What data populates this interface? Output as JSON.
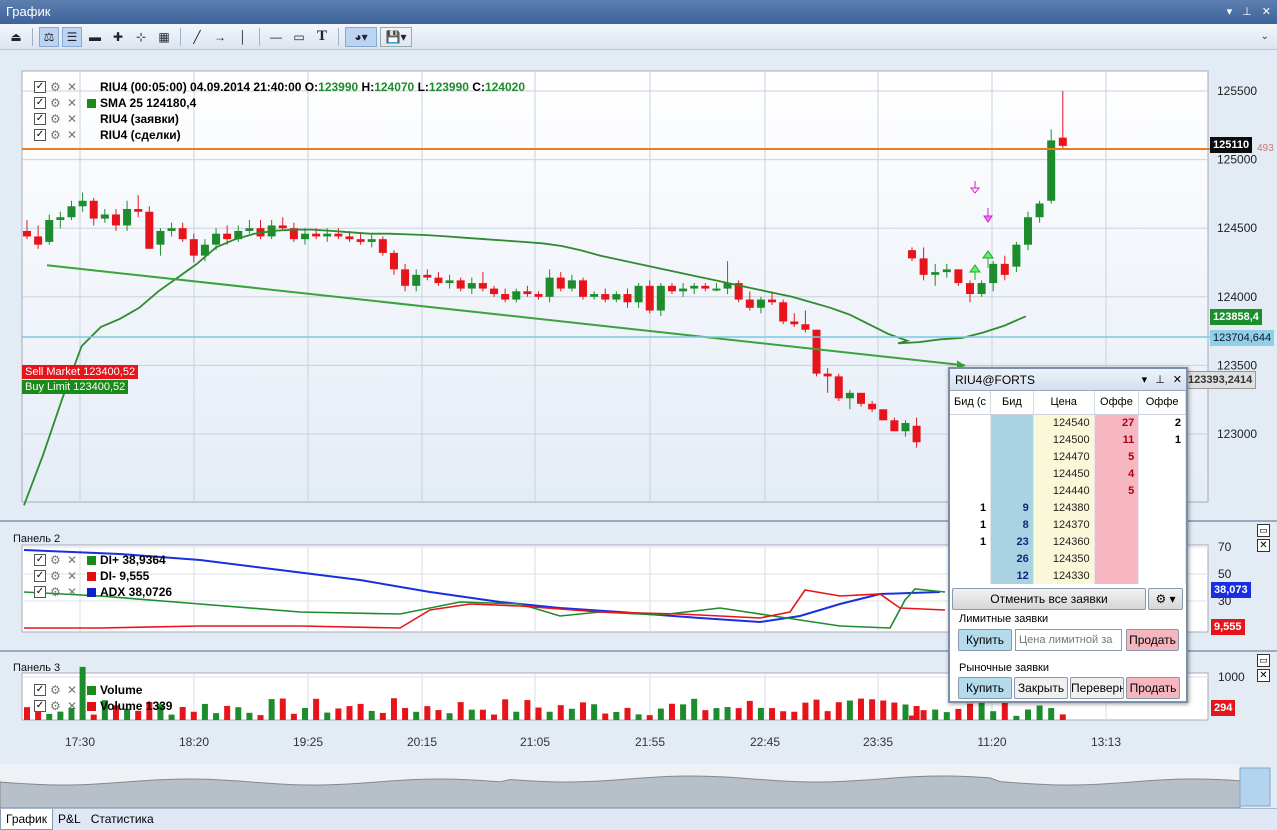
{
  "window": {
    "title": "График"
  },
  "toolbar": {
    "icons": [
      "open-icon",
      "candles-icon",
      "legend-icon",
      "horizontal-line-icon",
      "crosshair-icon",
      "marker-icon",
      "indicator-icon",
      "draw-line-icon",
      "arrow-icon",
      "vertical-line-icon",
      "hline-icon",
      "rectangle-icon",
      "text-icon",
      "color-icon",
      "save-icon"
    ]
  },
  "legend": {
    "main": [
      {
        "text": "RIU4 (00:05:00)  04.09.2014 21:40:00",
        "parts": [
          [
            "O:",
            "123990"
          ],
          [
            "H:",
            "124070"
          ],
          [
            "L:",
            "123990"
          ],
          [
            "C:",
            "124020"
          ]
        ]
      },
      {
        "text": "SMA 25  124180,4",
        "color": "#1a8a1a"
      },
      {
        "text": "RIU4 (заявки)"
      },
      {
        "text": "RIU4 (сделки)"
      }
    ],
    "panel2": [
      {
        "text": "DI+ 38,9364",
        "color": "#1a8a1a"
      },
      {
        "text": "DI- 9,555",
        "color": "#e01010"
      },
      {
        "text": "ADX 38,0726",
        "color": "#0a22c8"
      }
    ],
    "panel3": [
      {
        "text": "Volume",
        "color": "#1a8a1a"
      },
      {
        "text": "Volume 1339",
        "color": "#e01010"
      }
    ]
  },
  "panels": {
    "panel2_title": "Панель 2",
    "panel3_title": "Панель 3"
  },
  "axis": {
    "price_ticks": [
      "125500",
      "125000",
      "124500",
      "124000",
      "123500",
      "123000"
    ],
    "panel2_ticks": [
      "70",
      "50",
      "30"
    ],
    "panel3_ticks": [
      "1000"
    ],
    "time_ticks": [
      "17:30",
      "18:20",
      "19:25",
      "20:15",
      "21:05",
      "21:55",
      "22:45",
      "23:35",
      "11:20",
      "13:13"
    ]
  },
  "price_boxes": {
    "last": "125110",
    "last_hidden": "493",
    "sma": "123858,4",
    "hline": "123704,644",
    "cursor": "123393,2414",
    "di_plus": "38,073",
    "di_minus": "9,555",
    "volume": "294"
  },
  "orders": {
    "sell": "Sell Market 123400,52",
    "buy": "Buy Limit 123400,52"
  },
  "colors": {
    "bull": "#1d8c2d",
    "bear": "#e8141b",
    "sma": "#2e8b2e",
    "last_line": "#ee7b22",
    "hline": "#7ec8e3",
    "trend": "#3aa33a",
    "adx": "#1a2ee0"
  },
  "chart_data": {
    "type": "candlestick",
    "title": "RIU4 (00:05:00)",
    "last_close": 125110,
    "ylim": [
      122800,
      125650
    ],
    "candles": [
      [
        124480,
        124560,
        124420,
        124440
      ],
      [
        124440,
        124520,
        124350,
        124380
      ],
      [
        124400,
        124600,
        124380,
        124560
      ],
      [
        124560,
        124620,
        124500,
        124580
      ],
      [
        124580,
        124700,
        124560,
        124660
      ],
      [
        124660,
        124760,
        124620,
        124700
      ],
      [
        124700,
        124720,
        124520,
        124570
      ],
      [
        124570,
        124640,
        124540,
        124600
      ],
      [
        124600,
        124640,
        124480,
        124520
      ],
      [
        124520,
        124700,
        124480,
        124640
      ],
      [
        124640,
        124740,
        124580,
        124620
      ],
      [
        124620,
        124660,
        124350,
        124350
      ],
      [
        124380,
        124500,
        124300,
        124480
      ],
      [
        124480,
        124540,
        124440,
        124500
      ],
      [
        124500,
        124540,
        124400,
        124420
      ],
      [
        124420,
        124460,
        124250,
        124300
      ],
      [
        124300,
        124420,
        124260,
        124380
      ],
      [
        124380,
        124500,
        124340,
        124460
      ],
      [
        124460,
        124520,
        124380,
        124420
      ],
      [
        124420,
        124520,
        124400,
        124480
      ],
      [
        124480,
        124560,
        124460,
        124500
      ],
      [
        124500,
        124560,
        124420,
        124440
      ],
      [
        124440,
        124560,
        124420,
        124520
      ],
      [
        124520,
        124580,
        124480,
        124500
      ],
      [
        124500,
        124540,
        124400,
        124420
      ],
      [
        124420,
        124500,
        124380,
        124460
      ],
      [
        124460,
        124500,
        124420,
        124440
      ],
      [
        124440,
        124500,
        124400,
        124460
      ],
      [
        124460,
        124500,
        124420,
        124440
      ],
      [
        124440,
        124480,
        124400,
        124420
      ],
      [
        124420,
        124460,
        124380,
        124400
      ],
      [
        124400,
        124460,
        124360,
        124420
      ],
      [
        124420,
        124440,
        124300,
        124320
      ],
      [
        124320,
        124340,
        124160,
        124200
      ],
      [
        124200,
        124240,
        124040,
        124080
      ],
      [
        124080,
        124200,
        124040,
        124160
      ],
      [
        124160,
        124200,
        124120,
        124140
      ],
      [
        124140,
        124180,
        124080,
        124100
      ],
      [
        124100,
        124160,
        124060,
        124120
      ],
      [
        124120,
        124140,
        124040,
        124060
      ],
      [
        124060,
        124140,
        124020,
        124100
      ],
      [
        124100,
        124180,
        124040,
        124060
      ],
      [
        124060,
        124080,
        124000,
        124020
      ],
      [
        124020,
        124060,
        123960,
        123980
      ],
      [
        123980,
        124060,
        123960,
        124040
      ],
      [
        124040,
        124080,
        124000,
        124020
      ],
      [
        124020,
        124040,
        123980,
        124000
      ],
      [
        124000,
        124200,
        123960,
        124140
      ],
      [
        124140,
        124180,
        124040,
        124060
      ],
      [
        124060,
        124160,
        124040,
        124120
      ],
      [
        124120,
        124140,
        123980,
        124000
      ],
      [
        124000,
        124040,
        123980,
        124020
      ],
      [
        124020,
        124060,
        123960,
        123980
      ],
      [
        123980,
        124040,
        123960,
        124020
      ],
      [
        124020,
        124060,
        123920,
        123960
      ],
      [
        123960,
        124100,
        123920,
        124080
      ],
      [
        124080,
        124120,
        123880,
        123900
      ],
      [
        123900,
        124100,
        123860,
        124080
      ],
      [
        124080,
        124100,
        124020,
        124040
      ],
      [
        124040,
        124100,
        124000,
        124060
      ],
      [
        124060,
        124100,
        124020,
        124080
      ],
      [
        124080,
        124100,
        124040,
        124060
      ],
      [
        124060,
        124100,
        124040,
        124060
      ],
      [
        124060,
        124260,
        124020,
        124100
      ],
      [
        124100,
        124120,
        123960,
        123980
      ],
      [
        123980,
        124040,
        123900,
        123920
      ],
      [
        123920,
        124000,
        123880,
        123980
      ],
      [
        123980,
        124040,
        123940,
        123960
      ],
      [
        123960,
        123980,
        123800,
        123820
      ],
      [
        123820,
        123880,
        123780,
        123800
      ],
      [
        123800,
        123900,
        123740,
        123760
      ],
      [
        123760,
        123760,
        123420,
        123440
      ],
      [
        123440,
        123480,
        123300,
        123420
      ],
      [
        123420,
        123440,
        123240,
        123260
      ],
      [
        123260,
        123320,
        123180,
        123300
      ],
      [
        123300,
        123300,
        123200,
        123220
      ],
      [
        123220,
        123240,
        123160,
        123180
      ],
      [
        123180,
        123180,
        123100,
        123100
      ],
      [
        123100,
        123120,
        123020,
        123020
      ],
      [
        123020,
        123100,
        122980,
        123080
      ],
      [
        123060,
        123120,
        122900,
        122940
      ],
      [
        124340,
        124360,
        124260,
        124280
      ],
      [
        124280,
        124360,
        124120,
        124160
      ],
      [
        124160,
        124240,
        124080,
        124180
      ],
      [
        124180,
        124240,
        124140,
        124200
      ],
      [
        124200,
        124200,
        124080,
        124100
      ],
      [
        124100,
        124120,
        123960,
        124020
      ],
      [
        124020,
        124120,
        124000,
        124100
      ],
      [
        124100,
        124260,
        124040,
        124240
      ],
      [
        124240,
        124300,
        124120,
        124160
      ],
      [
        124220,
        124400,
        124180,
        124380
      ],
      [
        124380,
        124620,
        124340,
        124580
      ],
      [
        124580,
        124700,
        124540,
        124680
      ],
      [
        124700,
        125220,
        124680,
        125140
      ],
      [
        125160,
        125500,
        125080,
        125100
      ]
    ],
    "sma_points": [
      [
        0,
        122480
      ],
      [
        1,
        122850
      ],
      [
        2,
        123260
      ],
      [
        3,
        123640
      ],
      [
        4,
        123780
      ],
      [
        5,
        123840
      ],
      [
        6,
        123920
      ],
      [
        7,
        124040
      ],
      [
        8,
        124140
      ],
      [
        9,
        124240
      ],
      [
        10,
        124360
      ],
      [
        11,
        124420
      ],
      [
        12,
        124460
      ],
      [
        13,
        124480
      ],
      [
        14,
        124490
      ],
      [
        15,
        124490
      ],
      [
        16,
        124480
      ],
      [
        17,
        124470
      ],
      [
        18,
        124460
      ],
      [
        19,
        124460
      ],
      [
        20,
        124455
      ],
      [
        21,
        124450
      ],
      [
        22,
        124440
      ],
      [
        23,
        124430
      ],
      [
        24,
        124420
      ],
      [
        25,
        124410
      ],
      [
        26,
        124400
      ],
      [
        27,
        124390
      ],
      [
        28,
        124370
      ],
      [
        29,
        124340
      ],
      [
        30,
        124300
      ],
      [
        31,
        124270
      ],
      [
        32,
        124240
      ],
      [
        33,
        124210
      ],
      [
        34,
        124180
      ],
      [
        35,
        124150
      ],
      [
        36,
        124120
      ],
      [
        37,
        124090
      ],
      [
        38,
        124060
      ],
      [
        39,
        124030
      ],
      [
        40,
        124000
      ],
      [
        41,
        123960
      ],
      [
        42,
        123920
      ],
      [
        43,
        123870
      ],
      [
        44,
        123800
      ],
      [
        45,
        123730
      ],
      [
        46,
        123680
      ],
      [
        47,
        123660
      ],
      [
        48,
        123670
      ],
      [
        49,
        123690
      ],
      [
        50,
        123700
      ],
      [
        51,
        123740
      ],
      [
        52,
        123790
      ],
      [
        53,
        123858
      ]
    ],
    "trend_line": [
      [
        124230,
        0.0
      ],
      [
        123500,
        1.0
      ]
    ],
    "panel2": {
      "ylim": [
        0,
        80
      ],
      "DI+": 38.9364,
      "DI-": 9.555,
      "ADX": 38.0726
    },
    "panel3": {
      "ylim": [
        0,
        1200
      ],
      "volume_last": 294,
      "volume_series_2": 1339
    }
  },
  "dom": {
    "title": "RIU4@FORTS",
    "columns": [
      "Бид (с",
      "Бид",
      "Цена",
      "Оффе",
      "Оффе"
    ],
    "rows": [
      {
        "mybid": "",
        "bid": "",
        "price": "124540",
        "offer": "27",
        "myoffer": "2"
      },
      {
        "mybid": "",
        "bid": "",
        "price": "124500",
        "offer": "11",
        "myoffer": "1"
      },
      {
        "mybid": "",
        "bid": "",
        "price": "124470",
        "offer": "5",
        "myoffer": ""
      },
      {
        "mybid": "",
        "bid": "",
        "price": "124450",
        "offer": "4",
        "myoffer": ""
      },
      {
        "mybid": "",
        "bid": "",
        "price": "124440",
        "offer": "5",
        "myoffer": ""
      },
      {
        "mybid": "1",
        "bid": "9",
        "price": "124380",
        "offer": "",
        "myoffer": ""
      },
      {
        "mybid": "1",
        "bid": "8",
        "price": "124370",
        "offer": "",
        "myoffer": ""
      },
      {
        "mybid": "1",
        "bid": "23",
        "price": "124360",
        "offer": "",
        "myoffer": ""
      },
      {
        "mybid": "",
        "bid": "26",
        "price": "124350",
        "offer": "",
        "myoffer": ""
      },
      {
        "mybid": "",
        "bid": "12",
        "price": "124330",
        "offer": "",
        "myoffer": ""
      }
    ],
    "cancel_all": "Отменить все заявки",
    "limit_title": "Лимитные заявки",
    "limit_buy": "Купить",
    "limit_placeholder": "Цена лимитной за",
    "limit_sell": "Продать",
    "market_title": "Рыночные заявки",
    "market_buy": "Купить",
    "market_close": "Закрыть",
    "market_reverse": "Переверн",
    "market_sell": "Продать"
  },
  "tabs": [
    "График",
    "P&L",
    "Статистика"
  ]
}
